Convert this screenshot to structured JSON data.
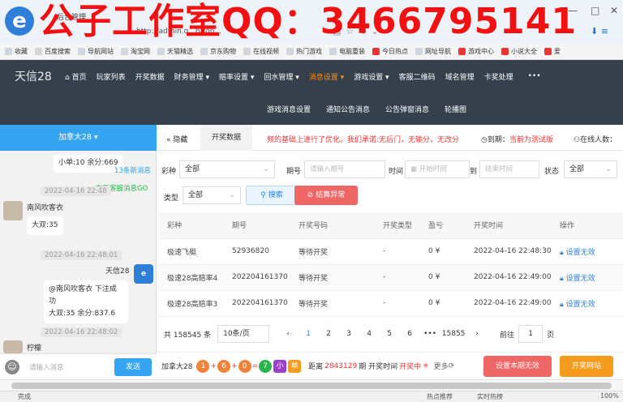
{
  "browser": {
    "tab_title": "后台管理",
    "url": "http://admin.q...p/top...",
    "watermark": "公子工作室QQ：3466795141",
    "bookmarks": [
      "收藏",
      "百度搜索",
      "导航网站",
      "淘宝网",
      "天猫精选",
      "京东购物",
      "在线视频",
      "热门游戏",
      "电脑重装",
      "今日热点",
      "网址导航",
      "游戏中心",
      "小说大全",
      "爱"
    ]
  },
  "nav": {
    "brand": "天信28",
    "items": [
      "首页",
      "玩家列表",
      "开奖数据",
      "财务管理 ▾",
      "赔率设置 ▾",
      "回水管理 ▾",
      "消息设置 ▾",
      "游戏设置 ▾",
      "客服二维码",
      "域名管理",
      "卡奖处理"
    ],
    "more": "•••",
    "sub_items": [
      "游戏消息设置",
      "通知公告消息",
      "公告弹窗消息",
      "轮播图"
    ]
  },
  "chat": {
    "header": "加拿大28 ▾",
    "partial_msg": "小单:10 余分:669",
    "new_msg_13": "13条新消息",
    "new_service_msg": "有新客服消息GO",
    "ts1": "2022-04-16 22:48",
    "user1_name": "南风吹客衣",
    "user1_msg": "大双:35",
    "ts2": "2022-04-16 22:48:01",
    "bot_name": "天信28",
    "bot_msg_line1": "@南风吹客衣 下注成功",
    "bot_msg_line2": "大双:35 余分:837.6",
    "ts3": "2022-04-16 22:48:02",
    "user2_name_partial": "柠檬",
    "input_placeholder": "请输入消息",
    "send": "发送"
  },
  "tabs": {
    "hide": "« 隐藏",
    "active": "开奖数据",
    "marquee": "频的基础上进行了优化。我们承诺:无后门，无输分，无改分",
    "expire_label": "到期：",
    "expire_value": "当前为测试版",
    "online": "在线人数："
  },
  "filters": {
    "lottery_label": "彩种",
    "lottery_value": "全部",
    "issue_label": "期号",
    "issue_placeholder": "请输入期号",
    "time_label": "时间",
    "start_placeholder": "开始时间",
    "to": "到",
    "end_placeholder": "结束时间",
    "status_label": "状态",
    "status_value": "全部",
    "type_label": "类型",
    "type_value": "全部",
    "search_btn": "搜索",
    "settle_btn": "结算异常"
  },
  "table": {
    "headers": [
      "彩种",
      "期号",
      "开奖号码",
      "开奖类型",
      "盈亏",
      "开奖时间",
      "操作"
    ],
    "rows": [
      [
        "极速飞艇",
        "52936820",
        "等待开奖",
        "-",
        "0 ¥",
        "2022-04-16 22:48:30",
        "设置无效"
      ],
      [
        "极速28高赔率4",
        "202204161370",
        "等待开奖",
        "-",
        "0 ¥",
        "2022-04-16 22:49:00",
        "设置无效"
      ],
      [
        "极速28高赔率3",
        "202204161370",
        "等待开奖",
        "-",
        "0 ¥",
        "2022-04-16 22:49:00",
        "设置无效"
      ]
    ]
  },
  "pager": {
    "total": "共 158545 条",
    "per_page": "10条/页",
    "pages": [
      "1",
      "2",
      "3",
      "4",
      "5",
      "6",
      "•••",
      "15855"
    ],
    "goto_label": "前往",
    "goto_value": "1",
    "page_suffix": "页"
  },
  "bottom": {
    "game": "加拿大28",
    "balls": [
      "1",
      "6",
      "0",
      "7"
    ],
    "ops": [
      "+",
      "+",
      "="
    ],
    "tag_small": "小",
    "tag_single": "单",
    "countdown_label": "距离",
    "issue": "2843129",
    "period_label": "期 开奖时间",
    "drawing": "开奖中",
    "more": "更多",
    "set_invalid_btn": "设置本期无效",
    "open_site_btn": "开奖网站"
  },
  "status": {
    "left": "完成",
    "items": [
      "热点推荐",
      "实时热榜",
      "100%"
    ]
  },
  "colors": {
    "nav_bg": "#35404c",
    "chat_header": "#35a4f1",
    "active_nav": "#f78d1f",
    "red_btn": "#ee6666",
    "orange_btn": "#f59c1f"
  }
}
